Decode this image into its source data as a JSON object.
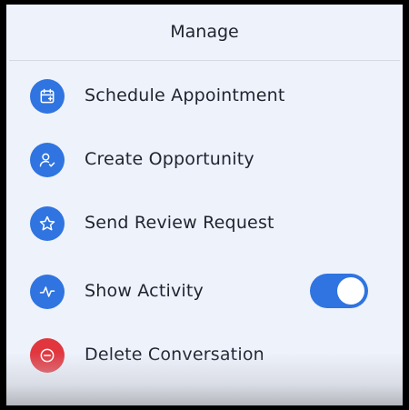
{
  "header": {
    "title": "Manage"
  },
  "menu": {
    "items": [
      {
        "label": "Schedule Appointment",
        "icon": "calendar-plus-icon"
      },
      {
        "label": "Create Opportunity",
        "icon": "user-check-icon"
      },
      {
        "label": "Send Review Request",
        "icon": "star-icon"
      },
      {
        "label": "Show Activity",
        "icon": "activity-icon",
        "toggle": true
      },
      {
        "label": "Delete Conversation",
        "icon": "minus-circle-icon"
      }
    ]
  },
  "colors": {
    "accent": "#2f74e0",
    "danger": "#e2363f",
    "background": "#eef2fb"
  }
}
